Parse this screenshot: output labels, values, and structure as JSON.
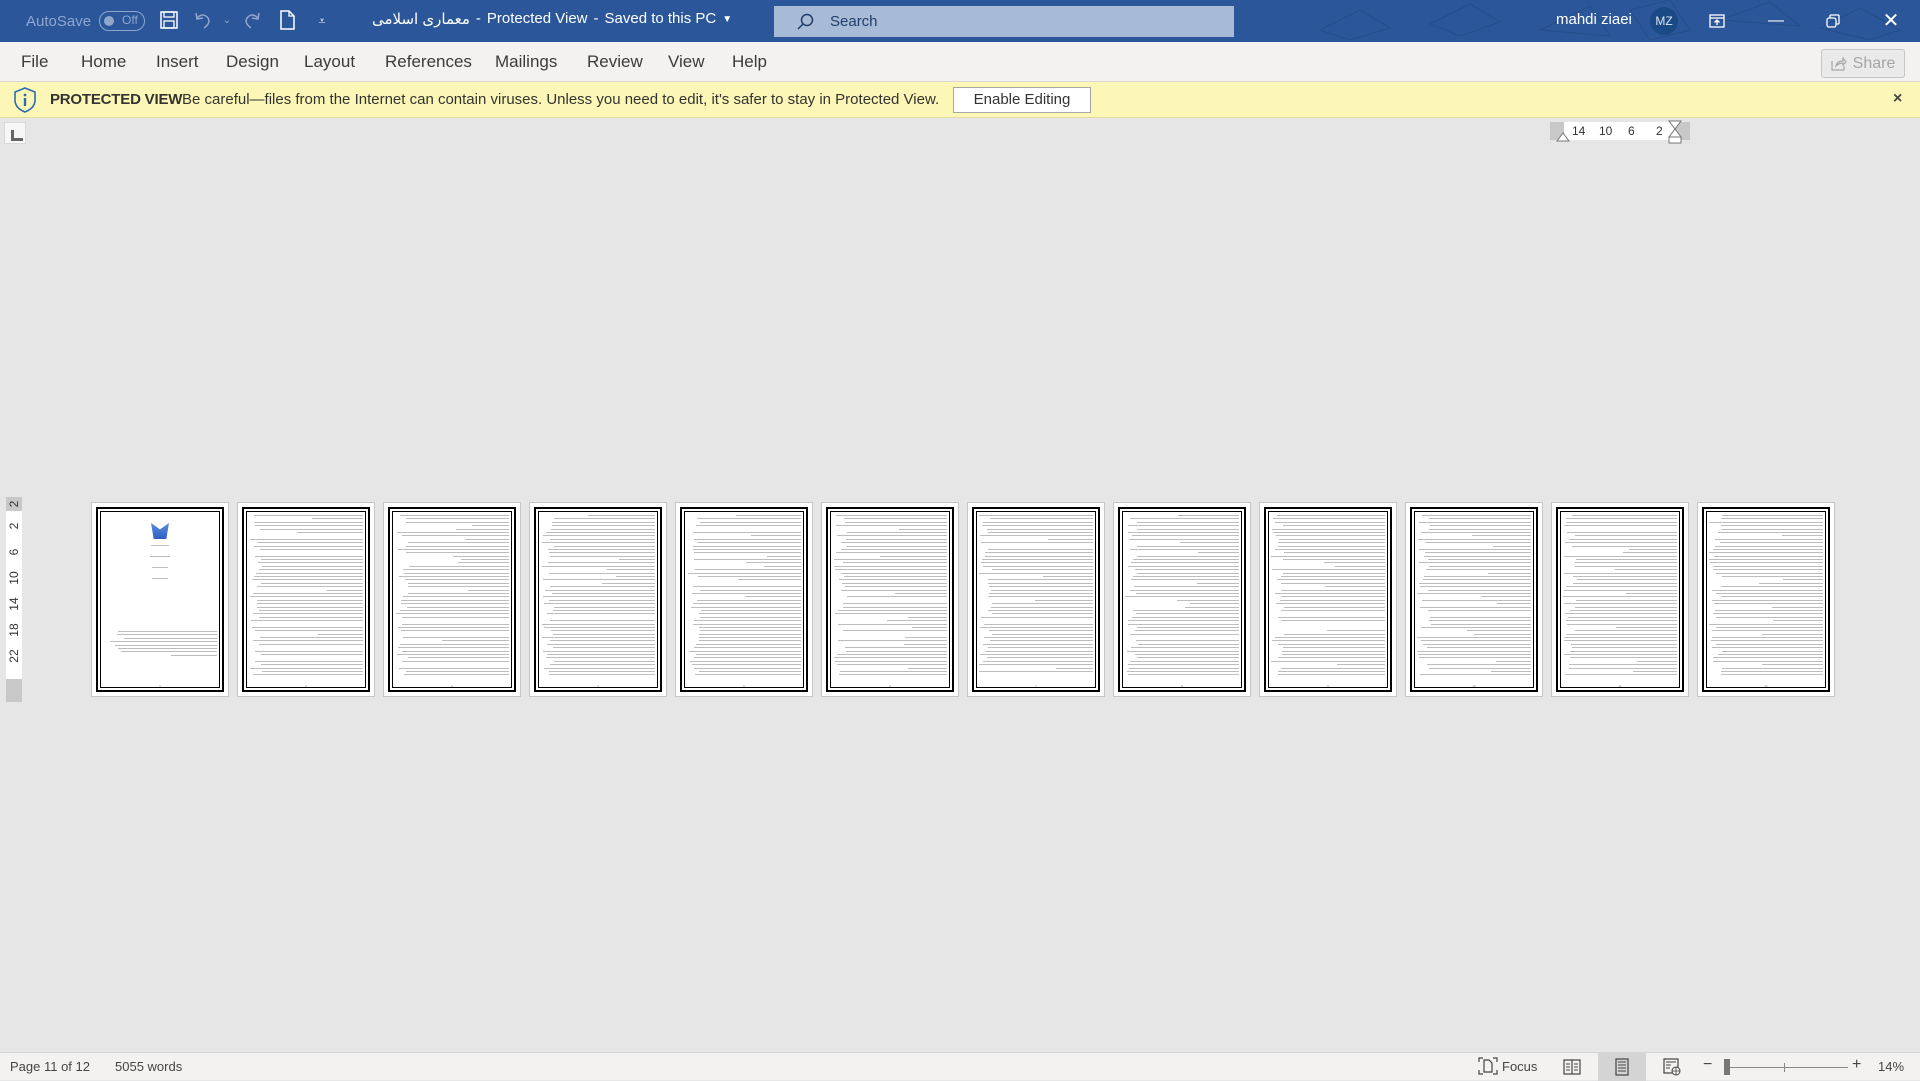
{
  "titlebar": {
    "autosave_label": "AutoSave",
    "autosave_state": "Off",
    "document_name": "معماری اسلامی",
    "separator": "-",
    "view_mode": "Protected View",
    "save_status": "Saved to this PC",
    "search_placeholder": "Search",
    "user_name": "mahdi ziaei",
    "user_initials": "MZ",
    "icons": {
      "save": "save-icon",
      "undo": "undo-icon",
      "redo": "redo-icon",
      "new": "new-document-icon",
      "customize": "customize-quick-access-icon",
      "ribbon_display": "ribbon-display-options-icon",
      "minimize": "minimize-icon",
      "restore": "restore-icon",
      "close": "close-icon"
    }
  },
  "ribbon": {
    "tabs": [
      {
        "label": "File"
      },
      {
        "label": "Home"
      },
      {
        "label": "Insert"
      },
      {
        "label": "Design"
      },
      {
        "label": "Layout"
      },
      {
        "label": "References"
      },
      {
        "label": "Mailings"
      },
      {
        "label": "Review"
      },
      {
        "label": "View"
      },
      {
        "label": "Help"
      }
    ],
    "share_label": "Share"
  },
  "protected_view": {
    "label": "PROTECTED VIEW",
    "message": "Be careful—files from the Internet can contain viruses. Unless you need to edit, it's safer to stay in Protected View.",
    "enable_button": "Enable Editing",
    "close_symbol": "×",
    "bg_color": "#fcf7b6"
  },
  "rulers": {
    "horizontal_ticks": [
      "14",
      "10",
      "6",
      "2"
    ],
    "vertical_ticks": [
      "2",
      "2",
      "6",
      "10",
      "14",
      "18",
      "22"
    ]
  },
  "document": {
    "page_count": 12,
    "pages": [
      {
        "number": 1,
        "type": "cover"
      },
      {
        "number": 2,
        "type": "text"
      },
      {
        "number": 3,
        "type": "text"
      },
      {
        "number": 4,
        "type": "text"
      },
      {
        "number": 5,
        "type": "text"
      },
      {
        "number": 6,
        "type": "text"
      },
      {
        "number": 7,
        "type": "text"
      },
      {
        "number": 8,
        "type": "text"
      },
      {
        "number": 9,
        "type": "text"
      },
      {
        "number": 10,
        "type": "text"
      },
      {
        "number": 11,
        "type": "text"
      },
      {
        "number": 12,
        "type": "text"
      }
    ]
  },
  "statusbar": {
    "page_info": "Page 11 of 12",
    "word_count": "5055 words",
    "focus_label": "Focus",
    "zoom_minus": "−",
    "zoom_plus": "+",
    "zoom_level": "14%",
    "zoom_fraction": 0.14,
    "active_view": "print-layout"
  },
  "colors": {
    "titlebar": "#2b579a",
    "accent": "#2b579a"
  }
}
